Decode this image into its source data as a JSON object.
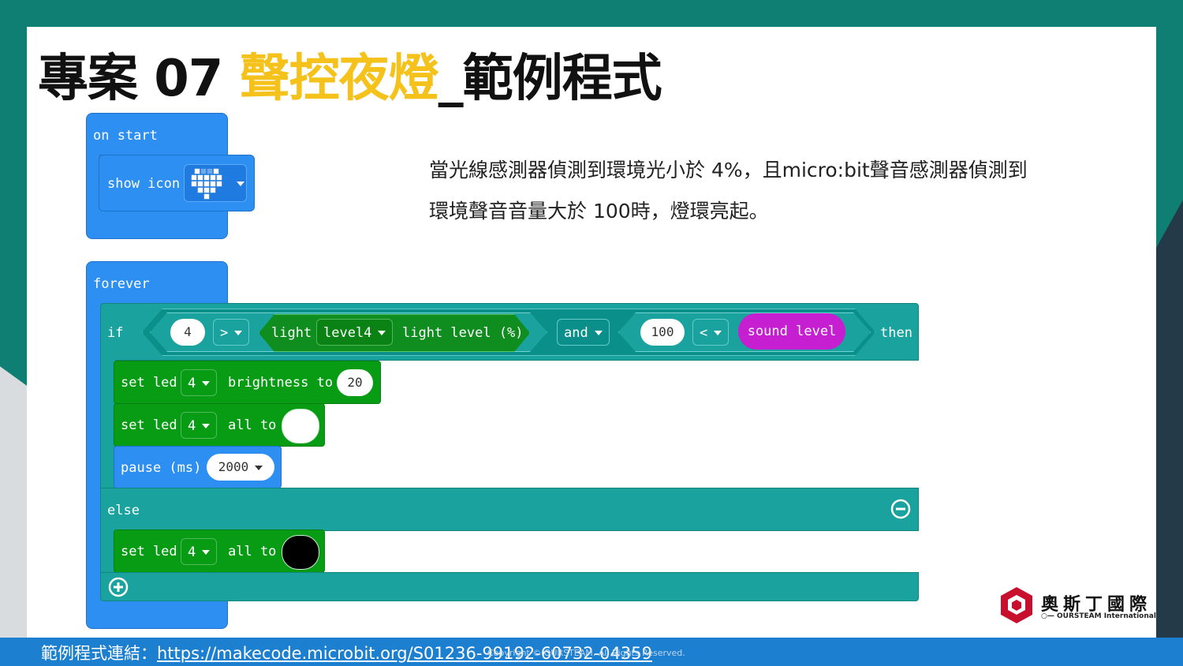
{
  "slide": {
    "title_prefix": "專案 07 ",
    "title_highlight": "聲控夜燈",
    "title_suffix": "_範例程式",
    "description": "當光線感測器偵測到環境光小於 4%，且micro:bit聲音感測器偵測到環境聲音音量大於 100時，燈環亮起。"
  },
  "colors": {
    "accent": "#f4c21b",
    "background_teal": "#0f7f73",
    "basic_block": "#2e8ff2",
    "logic_block": "#1aa39e",
    "led_block": "#089c14",
    "sound_block": "#c61fd1",
    "footer": "#1d7fd0"
  },
  "code": {
    "on_start": {
      "hat": "on start",
      "show_icon": "show icon",
      "icon": "heart-icon"
    },
    "forever": {
      "hat": "forever",
      "if_label": "if",
      "cond1_value": "4",
      "cond1_op": ">",
      "light_label": "light",
      "light_port": "level4",
      "light_level": "light level (%)",
      "and_label": "and",
      "cond2_value": "100",
      "cond2_op": "<",
      "sound_level": "sound level",
      "then_label": "then",
      "set_led": "set led",
      "led_port": "4",
      "brightness_to": "brightness to",
      "brightness_value": "20",
      "all_to": "all to",
      "pause_label": "pause (ms)",
      "pause_value": "2000",
      "else_label": "else",
      "color_on": "#ffffff",
      "color_off": "#000000"
    }
  },
  "footer": {
    "label": "範例程式連結：",
    "link": "https://makecode.microbit.org/S01236-99192-60732-04359",
    "copyright": "Copyright © OURSTEAM. All Rights Reserved."
  },
  "logo": {
    "name": "奧斯丁國際",
    "sub": "OURSTEAM International"
  }
}
